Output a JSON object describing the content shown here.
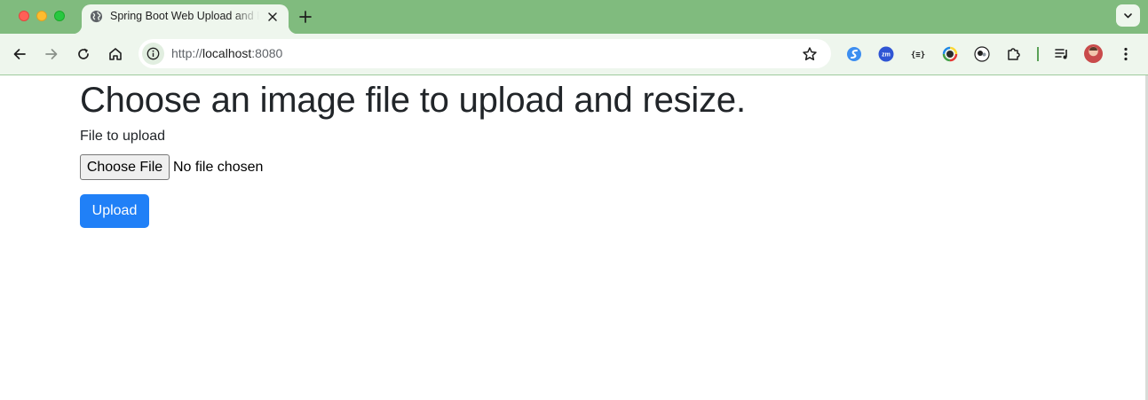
{
  "browser": {
    "tab": {
      "title": "Spring Boot Web Upload and Resize"
    },
    "address_bar": {
      "scheme": "http://",
      "host": "localhost",
      "port": ":8080"
    },
    "extensions": [
      "swirl-extension-icon",
      "zm-extension-icon",
      "braces-extension-icon",
      "color-ring-extension-icon",
      "cat-extension-icon",
      "puzzle-icon"
    ],
    "extension_labels": {
      "zm": "zm",
      "braces": "{≡}"
    },
    "colors": {
      "tabstrip": "#80bb7e",
      "toolbar": "#eef6ed"
    }
  },
  "page": {
    "heading": "Choose an image file to upload and resize.",
    "file_label": "File to upload",
    "choose_file_button": "Choose File",
    "file_status": "No file chosen",
    "upload_button": "Upload",
    "colors": {
      "primary": "#2080f7",
      "text": "#212529"
    }
  }
}
